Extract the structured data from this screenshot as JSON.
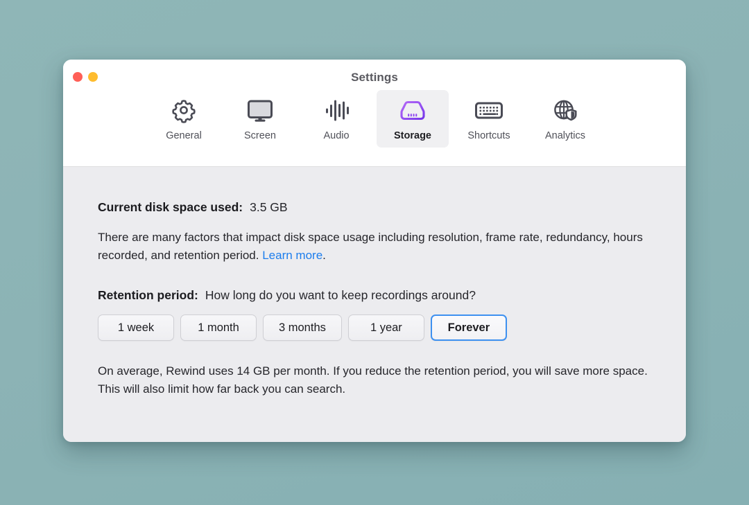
{
  "window": {
    "title": "Settings",
    "traffic_lights": [
      {
        "name": "close",
        "color": "#ff5f57"
      },
      {
        "name": "minimize",
        "color": "#febc2e"
      }
    ]
  },
  "tabs": [
    {
      "label": "General",
      "icon": "gear-icon",
      "active": false
    },
    {
      "label": "Screen",
      "icon": "monitor-icon",
      "active": false
    },
    {
      "label": "Audio",
      "icon": "waveform-icon",
      "active": false
    },
    {
      "label": "Storage",
      "icon": "hard-drive-icon",
      "active": true
    },
    {
      "label": "Shortcuts",
      "icon": "keyboard-icon",
      "active": false
    },
    {
      "label": "Analytics",
      "icon": "globe-shield-icon",
      "active": false
    }
  ],
  "content": {
    "disk_usage": {
      "label": "Current disk space used:",
      "value": "3.5 GB"
    },
    "description": {
      "before_link": "There are many factors that impact disk space usage including resolution, frame rate, redundancy, hours recorded, and retention period. ",
      "link_text": "Learn more",
      "after_link": "."
    },
    "retention": {
      "label": "Retention period:",
      "question": "How long do you want to keep recordings around?",
      "options": [
        {
          "label": "1 week",
          "selected": false
        },
        {
          "label": "1 month",
          "selected": false
        },
        {
          "label": "3 months",
          "selected": false
        },
        {
          "label": "1 year",
          "selected": false
        },
        {
          "label": "Forever",
          "selected": true
        }
      ]
    },
    "footnote": "On average, Rewind uses 14 GB per month. If you reduce the retention period, you will save more space. This will also limit how far back you can search."
  },
  "colors": {
    "desktop_background": "#8db4b6",
    "window_background": "#ececef",
    "toolbar_background": "#ffffff",
    "accent_selected_border": "#3d90f0",
    "link": "#1c7ded",
    "storage_icon_gradient_start": "#a855f7",
    "storage_icon_gradient_end": "#7c3aed",
    "icon_stroke": "#4a4b55"
  }
}
